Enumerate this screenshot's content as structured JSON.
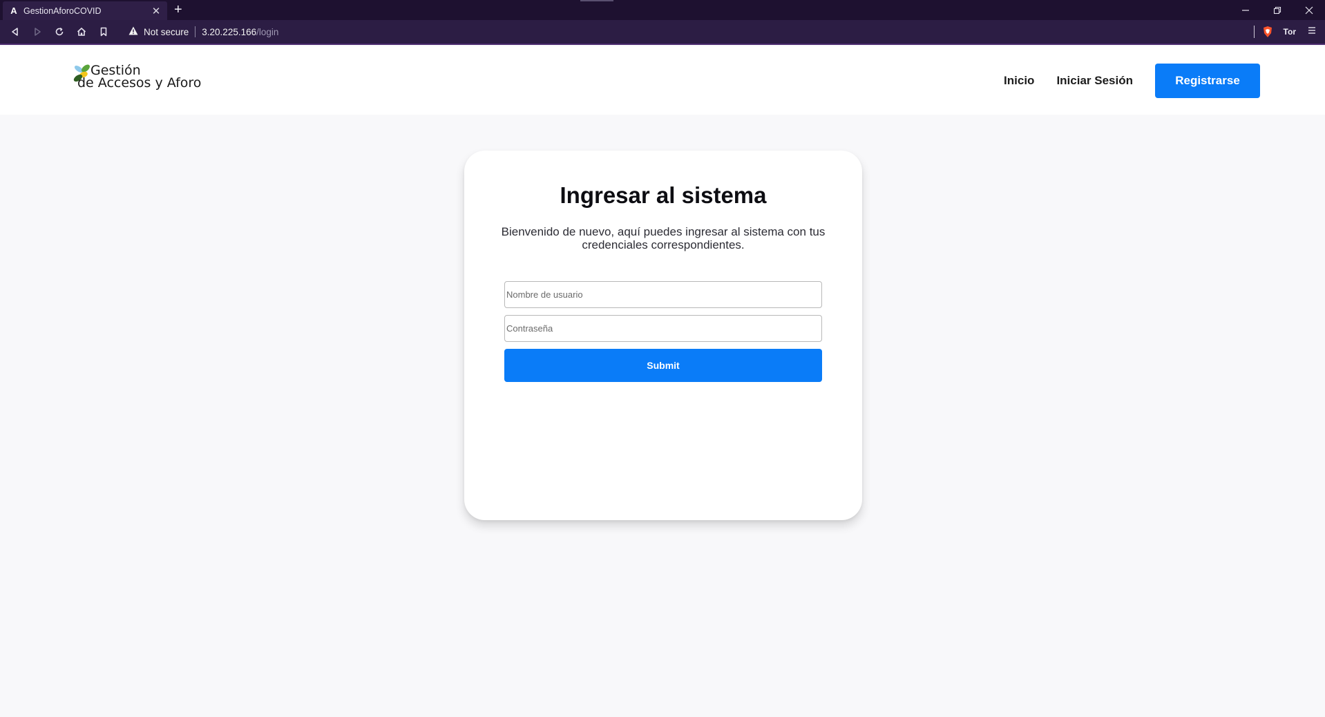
{
  "browser": {
    "tab": {
      "favicon": "A",
      "title": "GestionAforoCOVID",
      "close_icon": "close-icon"
    },
    "new_tab_icon": "plus-icon",
    "window_controls": [
      "minimize-icon",
      "restore-icon",
      "close-icon"
    ],
    "toolbar": {
      "icons": [
        "back-icon",
        "forward-icon",
        "reload-icon",
        "home-icon",
        "bookmark-icon"
      ],
      "security_label": "Not secure",
      "url_host": "3.20.225.166",
      "url_path": "/login",
      "tor_label": "Tor"
    }
  },
  "header": {
    "logo": {
      "line1": "Gestión",
      "line2": "de Accesos y Aforo",
      "leaf_colors": [
        "#8ec9ea",
        "#5aa43a",
        "#f3c519",
        "#2f5e22"
      ]
    },
    "nav": {
      "inicio": "Inicio",
      "iniciar_sesion": "Iniciar Sesión",
      "registrarse": "Registrarse"
    }
  },
  "login": {
    "title": "Ingresar al sistema",
    "subtitle": "Bienvenido de nuevo, aquí puedes ingresar al sistema con tus credenciales correspondientes.",
    "username_placeholder": "Nombre de usuario",
    "password_placeholder": "Contraseña",
    "submit_label": "Submit"
  },
  "colors": {
    "accent": "#0a7cf8",
    "page_background": "#f8f8fa",
    "browser_frame": "#2c1d44"
  }
}
